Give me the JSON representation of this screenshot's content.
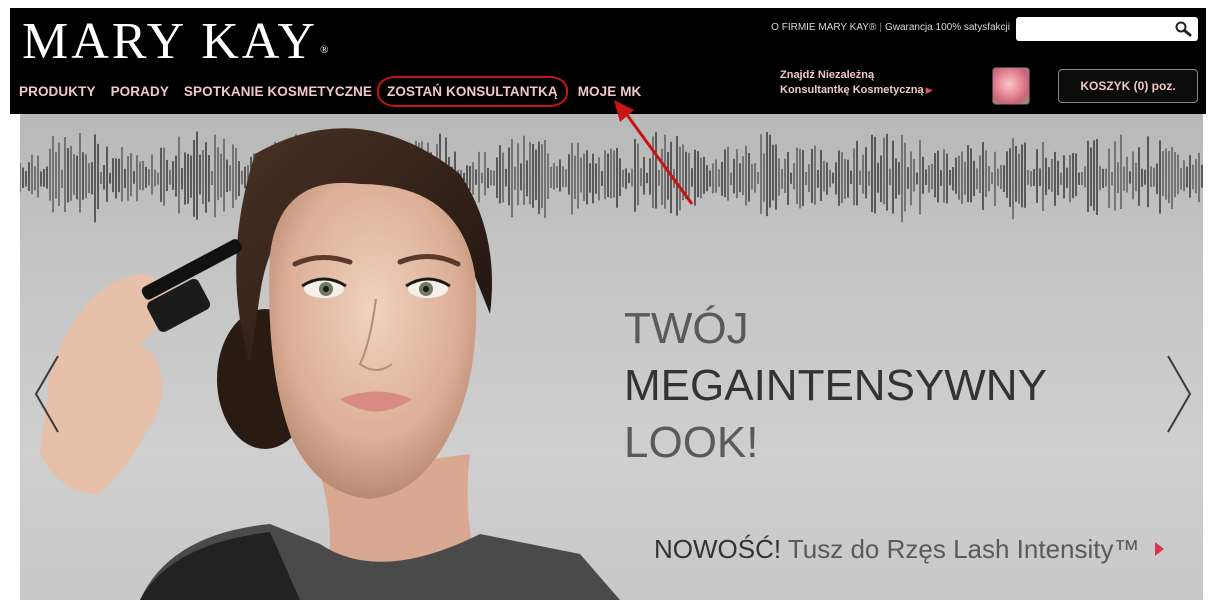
{
  "header": {
    "logo_text": "MARY KAY",
    "logo_mark": "®",
    "top_links": {
      "about": "O FIRMIE MARY KAY®",
      "guarantee": "Gwarancja 100% satysfakcji"
    },
    "search": {
      "placeholder": "",
      "icon": "search-icon"
    },
    "nav": [
      {
        "label": "PRODUKTY"
      },
      {
        "label": "PORADY"
      },
      {
        "label": "SPOTKANIE KOSMETYCZNE"
      },
      {
        "label": "ZOSTAŃ KONSULTANTKĄ"
      },
      {
        "label": "MOJE MK"
      }
    ],
    "find_consultant": {
      "line1": "Znajdź Niezależną",
      "line2": "Konsultantkę Kosmetyczną"
    },
    "cart": {
      "label": "KOSZYK",
      "count": "(0) poz."
    }
  },
  "hero": {
    "headline": [
      "TWÓJ",
      "MEGAINTENSYWNY",
      "LOOK!"
    ],
    "promo_new": "NOWOŚĆ!",
    "promo_text": "Tusz do Rzęs Lash Intensity™",
    "icons": {
      "prev": "chevron-left-icon",
      "next": "chevron-right-icon",
      "promo_arrow": "play-icon"
    }
  },
  "colors": {
    "header_bg": "#000000",
    "nav_text": "#f0c8c8",
    "annotation": "#c81414",
    "hero_bg": "#c6c6c6"
  }
}
